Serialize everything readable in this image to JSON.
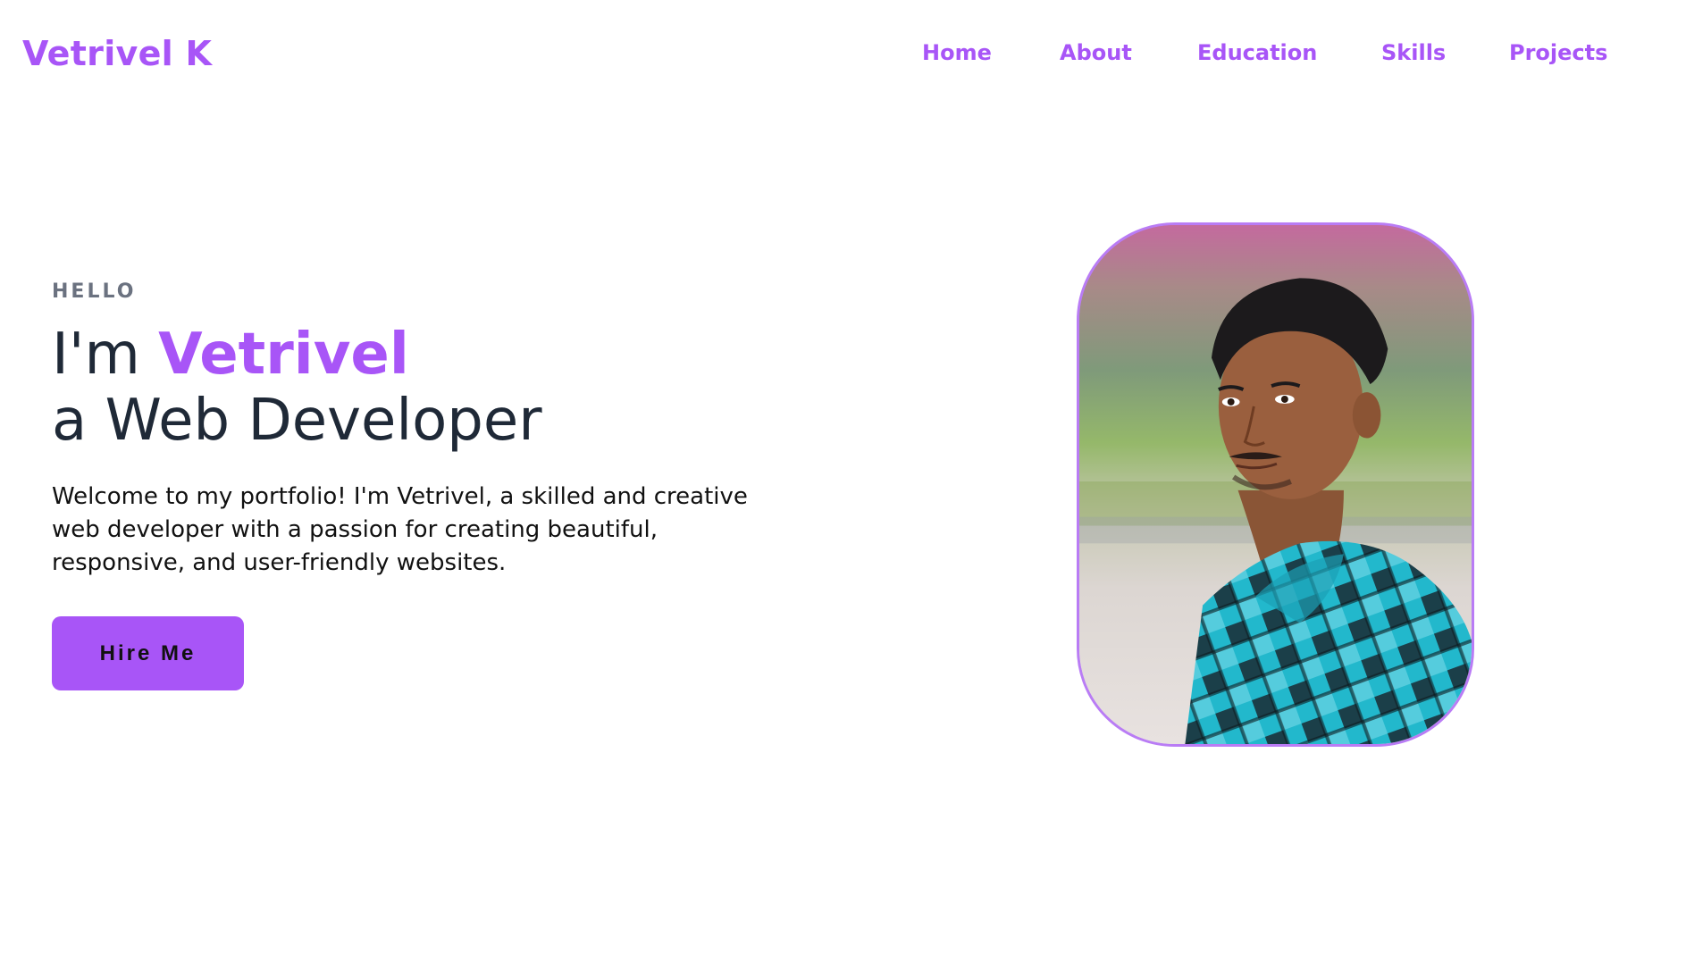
{
  "header": {
    "logo": "Vetrivel K",
    "nav": {
      "home": "Home",
      "about": "About",
      "education": "Education",
      "skills": "Skills",
      "projects": "Projects"
    }
  },
  "hero": {
    "greeting": "HELLO",
    "headline_prefix": "I'm ",
    "headline_name": "Vetrivel",
    "headline_line2": "a Web Developer",
    "intro": "Welcome to my portfolio! I'm Vetrivel, a skilled and creative web developer with a passion for creating beautiful, responsive, and user-friendly websites.",
    "cta_label": "Hire Me"
  },
  "profile_photo": {
    "icon": "profile-photo"
  },
  "colors": {
    "accent": "#a855f7",
    "heading": "#1f2937",
    "muted": "#6b7280",
    "background": "#ffffff"
  }
}
